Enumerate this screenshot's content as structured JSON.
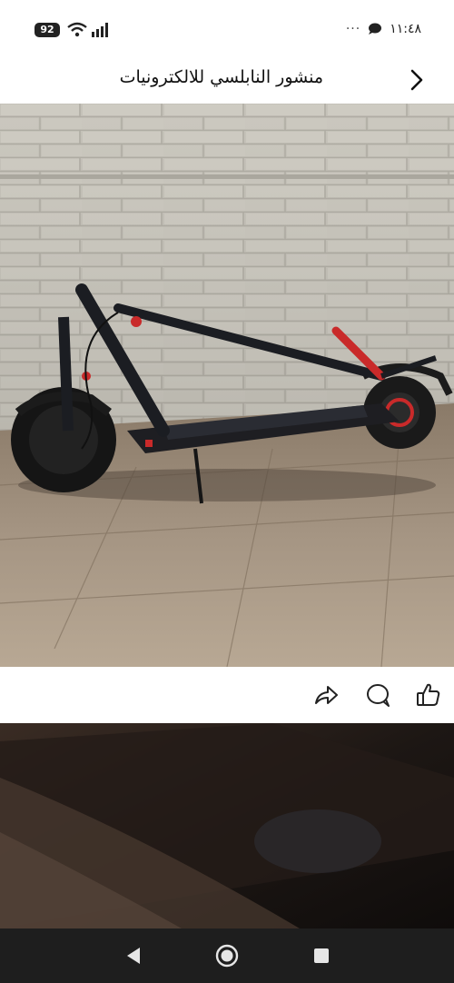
{
  "status_bar": {
    "battery": "92",
    "time": "١١:٤٨",
    "overflow": "···",
    "icons": [
      "battery-icon",
      "wifi-icon",
      "signal-icon",
      "chat-icon"
    ]
  },
  "header": {
    "title": "منشور النابلسي للالكترونيات",
    "back_icon": "chevron-right-icon"
  },
  "post": {
    "photo_description_icon": "scooter-photo",
    "actions": [
      "share-icon",
      "comment-icon",
      "like-icon"
    ]
  },
  "nav": {
    "buttons": [
      "back-triangle-icon",
      "home-circle-icon",
      "recents-square-icon"
    ]
  },
  "colors": {
    "nav_bg": "#1e1e1e",
    "accent_red": "#d2232a"
  }
}
